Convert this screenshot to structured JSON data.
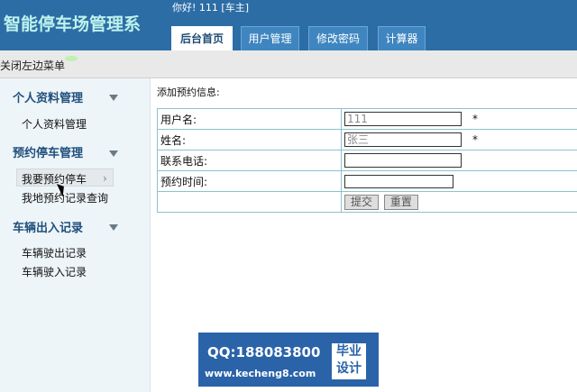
{
  "header": {
    "app_title": "智能停车场管理系",
    "welcome": "你好! 111 [车主]",
    "tabs": [
      {
        "label": "后台首页",
        "active": true
      },
      {
        "label": "用户管理",
        "active": false
      },
      {
        "label": "修改密码",
        "active": false
      },
      {
        "label": "计算器",
        "active": false
      }
    ]
  },
  "toolbar": {
    "toggle_menu": "关闭左边菜单"
  },
  "sidebar": {
    "sections": [
      {
        "title": "个人资料管理",
        "items": [
          "个人资料管理"
        ]
      },
      {
        "title": "预约停车管理",
        "items": [
          "我要预约停车",
          "我地预约记录查询"
        ]
      },
      {
        "title": "车辆出入记录",
        "items": [
          "车辆驶出记录",
          "车辆驶入记录"
        ]
      }
    ],
    "active_item": "我要预约停车"
  },
  "form": {
    "heading": "添加预约信息:",
    "rows": [
      {
        "label": "用户名:",
        "value": "111",
        "required": "*"
      },
      {
        "label": "姓名:",
        "value": "张三",
        "required": "*"
      },
      {
        "label": "联系电话:",
        "value": ""
      },
      {
        "label": "预约时间:",
        "value": ""
      }
    ],
    "submit_label": "提交",
    "reset_label": "重置"
  },
  "watermark": {
    "qq": "QQ:188083800",
    "url": "www.kecheng8.com",
    "badge_line1": "毕业",
    "badge_line2": "设计"
  },
  "colors": {
    "header_bg": "#2d6da6",
    "title_text": "#bdf2ec",
    "table_border": "#8bc2cf",
    "sidebar_bg": "#eef5f8"
  }
}
